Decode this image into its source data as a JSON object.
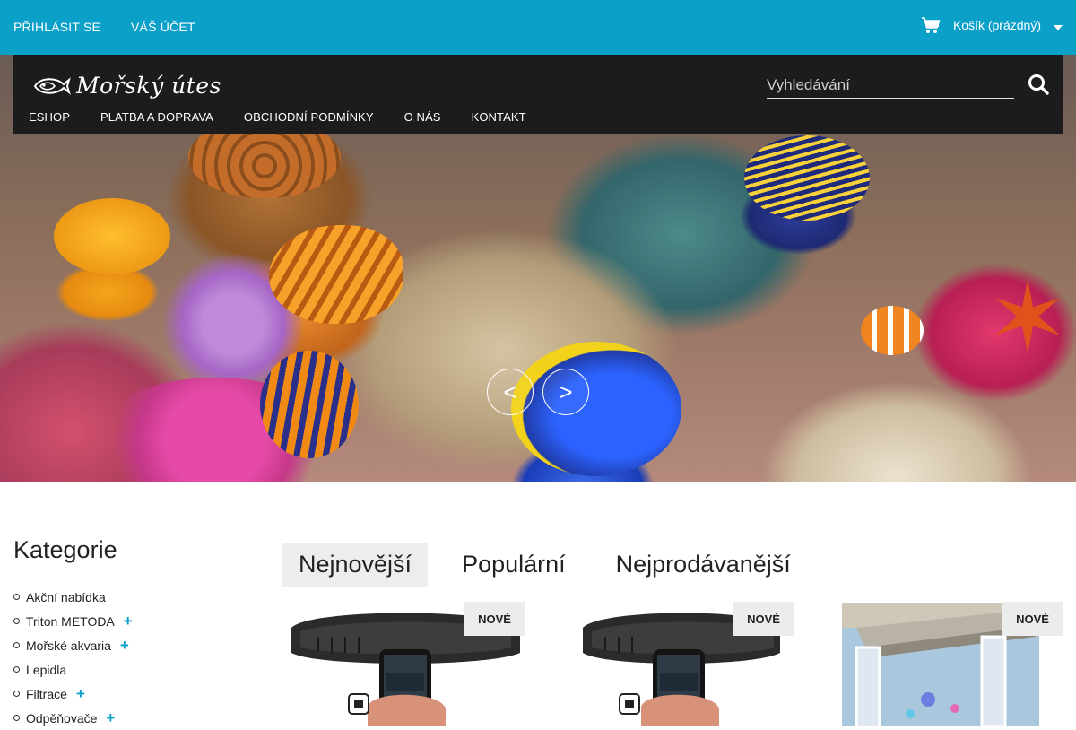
{
  "topbar": {
    "login": "PŘIHLÁSIT SE",
    "account": "VÁŠ ÚČET",
    "cart_label": "Košík (prázdný)",
    "cart_icon": "shopping-cart-icon",
    "caret_icon": "caret-down-icon",
    "background_color": "#0aa0c8"
  },
  "header": {
    "logo_text": "Mořský útes",
    "logo_icon": "fish-logo-icon",
    "nav": [
      "ESHOP",
      "PLATBA A DOPRAVA",
      "OBCHODNÍ PODMÍNKY",
      "O NÁS",
      "KONTAKT"
    ],
    "search": {
      "placeholder": "Vyhledávání",
      "value": "",
      "icon": "search-icon"
    }
  },
  "hero": {
    "prev_label": "<",
    "next_label": ">"
  },
  "sidebar": {
    "title": "Kategorie",
    "items": [
      {
        "label": "Akční nabídka",
        "expandable": false
      },
      {
        "label": "Triton METODA",
        "expandable": true
      },
      {
        "label": "Mořské akvaria",
        "expandable": true
      },
      {
        "label": "Lepidla",
        "expandable": false
      },
      {
        "label": "Filtrace",
        "expandable": true
      },
      {
        "label": "Odpěňovače",
        "expandable": true
      }
    ],
    "expand_symbol": "+"
  },
  "products": {
    "tabs": [
      "Nejnovější",
      "Populární",
      "Nejprodávanější"
    ],
    "active_tab": 0,
    "items": [
      {
        "badge": "NOVÉ"
      },
      {
        "badge": "NOVÉ"
      },
      {
        "badge": "NOVÉ"
      }
    ]
  }
}
